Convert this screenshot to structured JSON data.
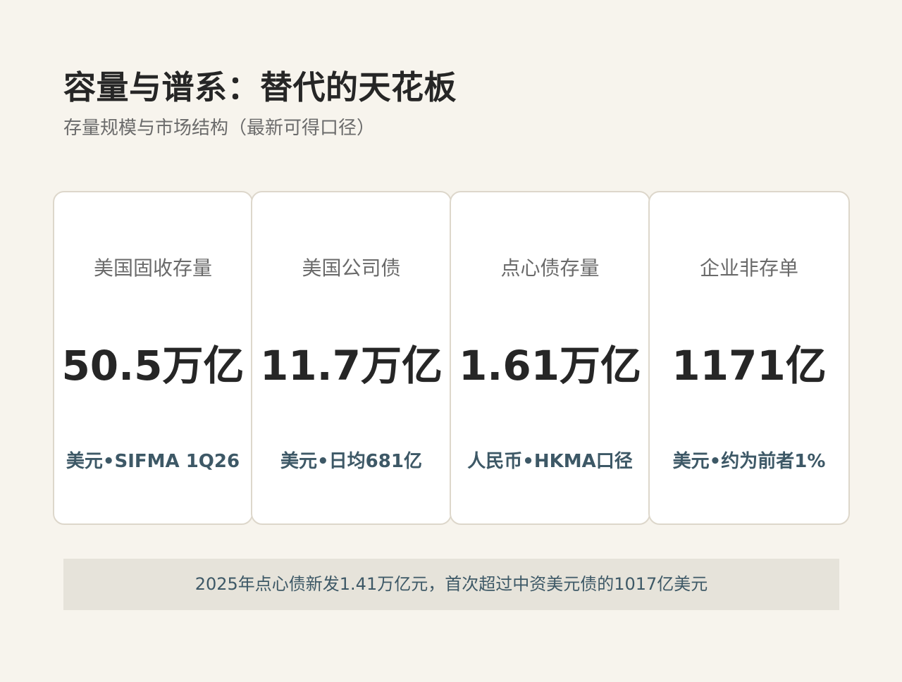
{
  "header": {
    "title": "容量与谱系：替代的天花板",
    "subtitle": "存量规模与市场结构（最新可得口径）"
  },
  "cards": [
    {
      "label": "美国固收存量",
      "value": "50.5万亿",
      "note": "美元•SIFMA 1Q26"
    },
    {
      "label": "美国公司债",
      "value": "11.7万亿",
      "note": "美元•日均681亿"
    },
    {
      "label": "点心债存量",
      "value": "1.61万亿",
      "note": "人民币•HKMA口径"
    },
    {
      "label": "企业非存单",
      "value": "1171亿",
      "note": "美元•约为前者1%"
    }
  ],
  "footer": {
    "text": "2025年点心债新发1.41万亿元，首次超过中资美元债的1017亿美元"
  },
  "colors": {
    "background": "#f7f4ed",
    "card_border": "#ddd7cb",
    "note_text": "#3d5866",
    "footer_bg": "#e6e3da"
  }
}
